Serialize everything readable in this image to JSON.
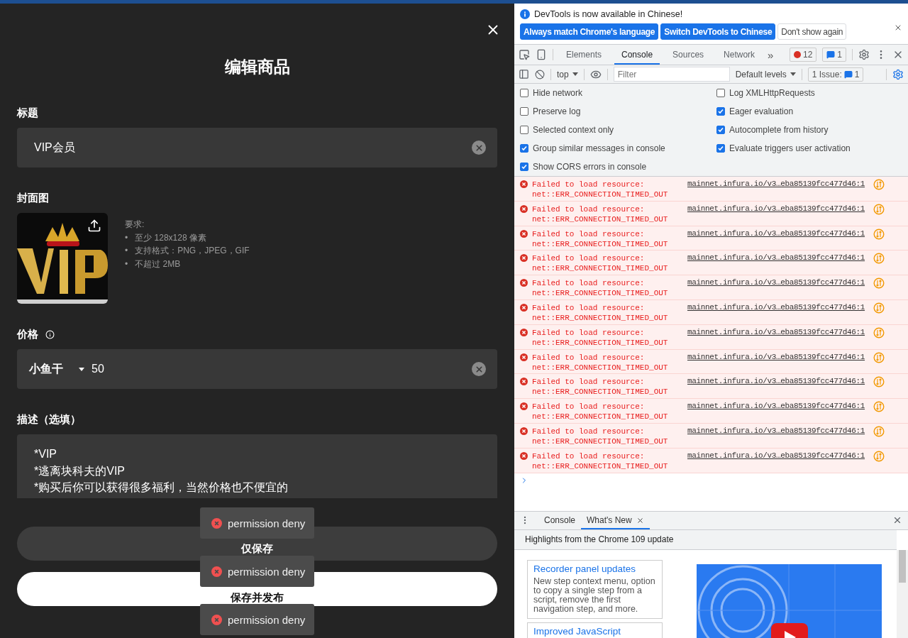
{
  "dialog": {
    "title": "编辑商品",
    "title_field": {
      "label": "标题",
      "value": "VIP会员"
    },
    "cover": {
      "label": "封面图",
      "requirements_title": "要求:",
      "requirements": [
        {
          "marker": "•",
          "text": "至少 128x128 像素"
        },
        {
          "marker": "•",
          "text": "支持格式：PNG，JPEG，GIF"
        },
        {
          "marker": "•",
          "text": "不超过 2MB"
        }
      ]
    },
    "price": {
      "label": "价格",
      "currency": "小鱼干",
      "value": "50"
    },
    "description": {
      "label": "描述（选填）",
      "value": "*VIP\n*逃离块科夫的VIP\n*购买后你可以获得很多福利，当然价格也不便宜的"
    },
    "buttons": [
      {
        "label": "仅保存",
        "kind": "secondary"
      },
      {
        "label": "保存并发布",
        "kind": "primary"
      }
    ]
  },
  "toasts": [
    {
      "text": "permission deny"
    },
    {
      "text": "permission deny"
    },
    {
      "text": "permission deny"
    }
  ],
  "devtools": {
    "infobar": {
      "message": "DevTools is now available in Chinese!",
      "buttons": [
        {
          "label": "Always match Chrome's language",
          "kind": "primary"
        },
        {
          "label": "Switch DevTools to Chinese",
          "kind": "primary"
        },
        {
          "label": "Don't show again",
          "kind": "secondary"
        }
      ]
    },
    "tabs": [
      {
        "label": "Elements",
        "selected": false
      },
      {
        "label": "Console",
        "selected": true
      },
      {
        "label": "Sources",
        "selected": false
      },
      {
        "label": "Network",
        "selected": false
      }
    ],
    "more": "»",
    "error_count": "12",
    "message_count": "1",
    "console_toolbar": {
      "context": "top",
      "filter_placeholder": "Filter",
      "levels": "Default levels",
      "issues_label": "1 Issue:",
      "issues_count": "1"
    },
    "settings_left": [
      {
        "label": "Hide network",
        "checked": false
      },
      {
        "label": "Preserve log",
        "checked": false
      },
      {
        "label": "Selected context only",
        "checked": false
      },
      {
        "label": "Group similar messages in console",
        "checked": true
      },
      {
        "label": "Show CORS errors in console",
        "checked": true
      }
    ],
    "settings_right": [
      {
        "label": "Log XMLHttpRequests",
        "checked": false
      },
      {
        "label": "Eager evaluation",
        "checked": true
      },
      {
        "label": "Autocomplete from history",
        "checked": true
      },
      {
        "label": "Evaluate triggers user activation",
        "checked": true
      }
    ],
    "messages": [
      {
        "text": "Failed to load resource: net::ERR_CONNECTION_TIMED_OUT",
        "source": "mainnet.infura.io/v3…eba85139fcc477d46:1"
      },
      {
        "text": "Failed to load resource: net::ERR_CONNECTION_TIMED_OUT",
        "source": "mainnet.infura.io/v3…eba85139fcc477d46:1"
      },
      {
        "text": "Failed to load resource: net::ERR_CONNECTION_TIMED_OUT",
        "source": "mainnet.infura.io/v3…eba85139fcc477d46:1"
      },
      {
        "text": "Failed to load resource: net::ERR_CONNECTION_TIMED_OUT",
        "source": "mainnet.infura.io/v3…eba85139fcc477d46:1"
      },
      {
        "text": "Failed to load resource: net::ERR_CONNECTION_TIMED_OUT",
        "source": "mainnet.infura.io/v3…eba85139fcc477d46:1"
      },
      {
        "text": "Failed to load resource: net::ERR_CONNECTION_TIMED_OUT",
        "source": "mainnet.infura.io/v3…eba85139fcc477d46:1"
      },
      {
        "text": "Failed to load resource: net::ERR_CONNECTION_TIMED_OUT",
        "source": "mainnet.infura.io/v3…eba85139fcc477d46:1"
      },
      {
        "text": "Failed to load resource: net::ERR_CONNECTION_TIMED_OUT",
        "source": "mainnet.infura.io/v3…eba85139fcc477d46:1"
      },
      {
        "text": "Failed to load resource: net::ERR_CONNECTION_TIMED_OUT",
        "source": "mainnet.infura.io/v3…eba85139fcc477d46:1"
      },
      {
        "text": "Failed to load resource: net::ERR_CONNECTION_TIMED_OUT",
        "source": "mainnet.infura.io/v3…eba85139fcc477d46:1"
      },
      {
        "text": "Failed to load resource: net::ERR_CONNECTION_TIMED_OUT",
        "source": "mainnet.infura.io/v3…eba85139fcc477d46:1"
      },
      {
        "text": "Failed to load resource: net::ERR_CONNECTION_TIMED_OUT",
        "source": "mainnet.infura.io/v3…eba85139fcc477d46:1"
      }
    ],
    "drawer": {
      "tabs": [
        {
          "label": "Console",
          "selected": false
        },
        {
          "label": "What's New",
          "selected": true
        }
      ],
      "heading": "Highlights from the Chrome 109 update",
      "cards": [
        {
          "title": "Recorder panel updates",
          "body": "New step context menu, option to copy a single step from a script, remove the first navigation step, and more."
        },
        {
          "title": "Improved JavaScript"
        }
      ]
    }
  }
}
